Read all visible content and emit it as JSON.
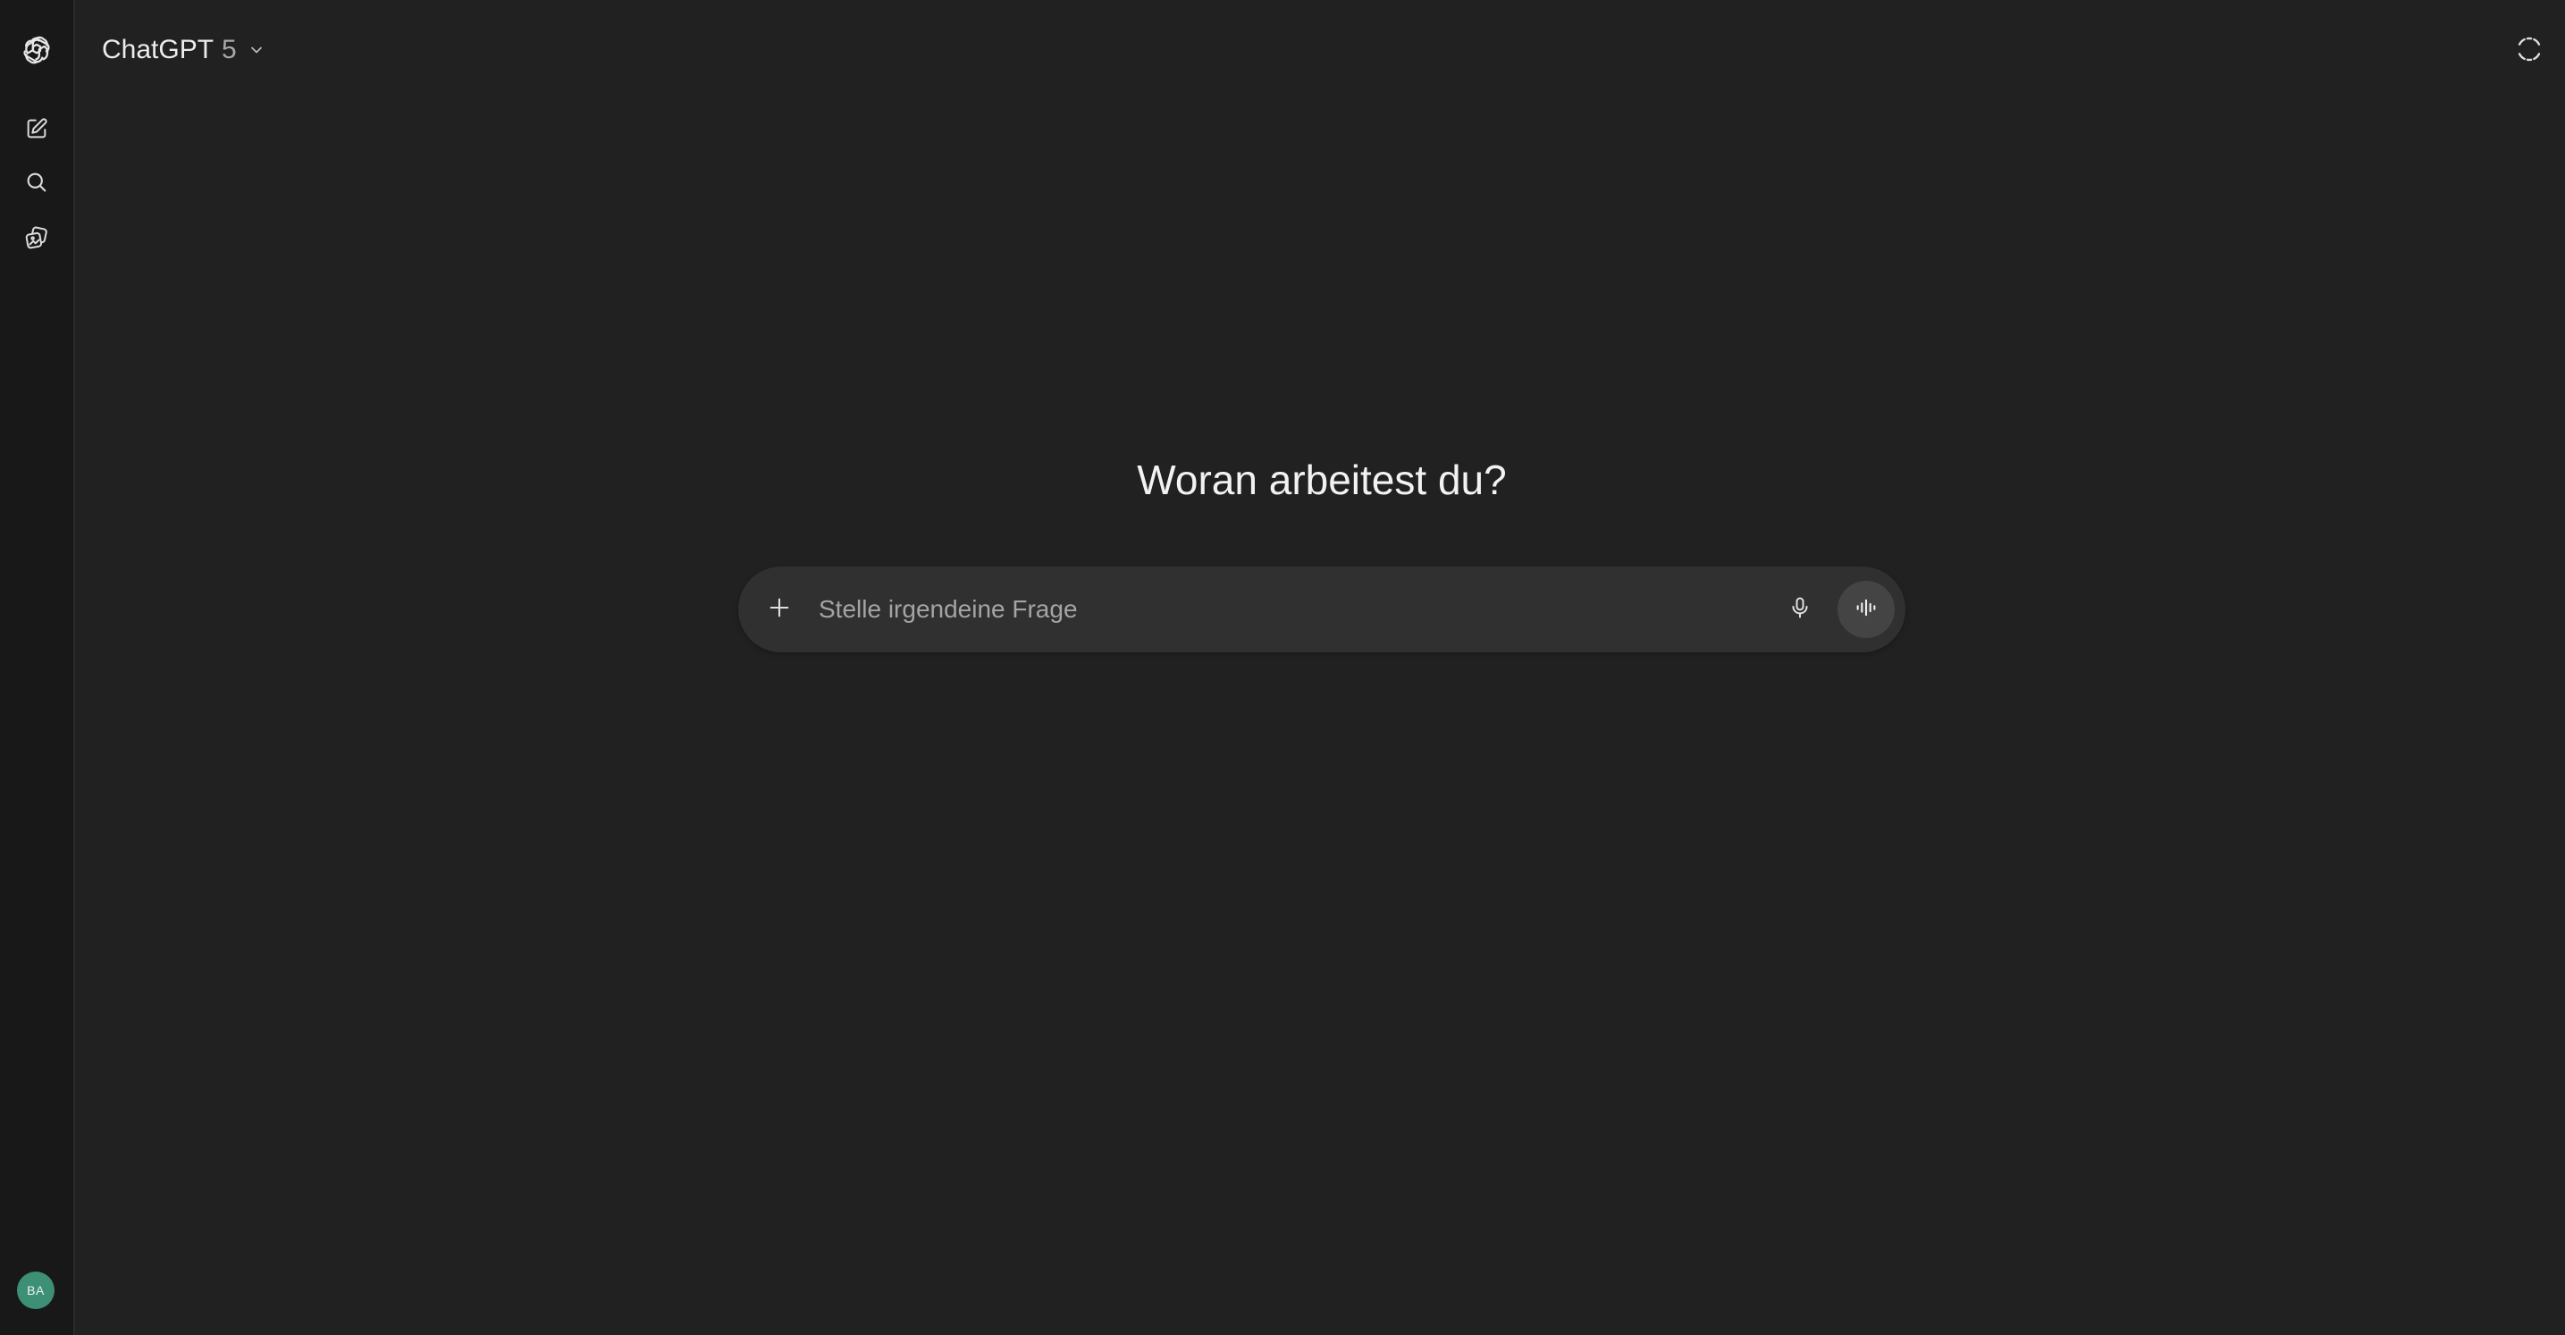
{
  "app": {
    "model_name": "ChatGPT",
    "model_version": "5"
  },
  "rail": {
    "items": [
      {
        "icon": "openai-logo-icon"
      },
      {
        "icon": "new-chat-icon"
      },
      {
        "icon": "search-icon"
      },
      {
        "icon": "library-icon"
      }
    ],
    "avatar_initials": "BA"
  },
  "main": {
    "headline": "Woran arbeitest du?"
  },
  "composer": {
    "placeholder": "Stelle irgendeine Frage",
    "value": ""
  },
  "colors": {
    "background": "#212121",
    "rail": "#181818",
    "composer": "#303030",
    "avatar": "#3d8f76"
  }
}
